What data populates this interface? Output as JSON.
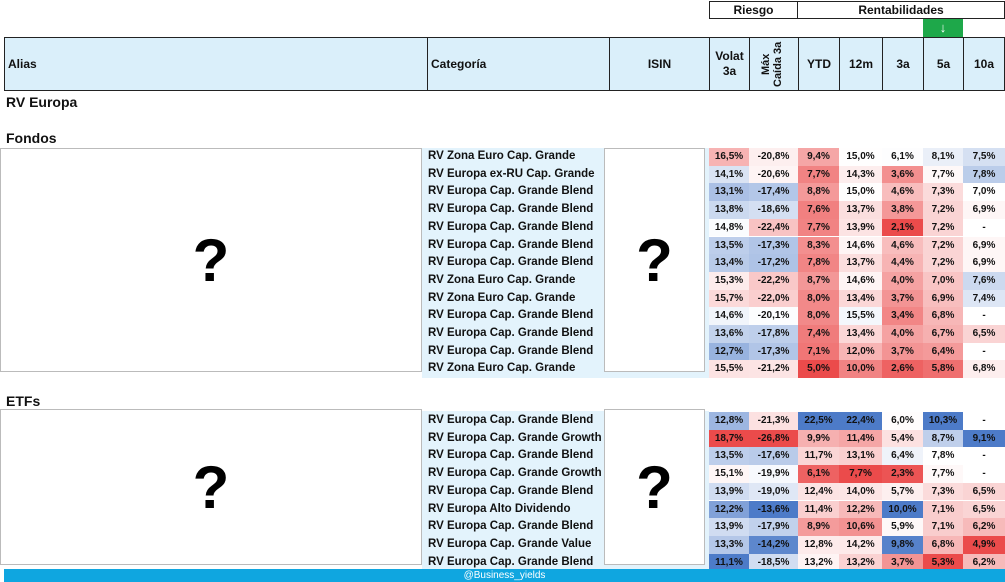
{
  "groups": {
    "risk": "Riesgo",
    "returns": "Rentabilidades"
  },
  "sort_arrow": "↓",
  "headers": {
    "alias": "Alias",
    "category": "Categoría",
    "isin": "ISIN",
    "vol": "Volat 3a",
    "maxdd": "Máx Caída 3a",
    "ytd": "YTD",
    "m12": "12m",
    "y3": "3a",
    "y5": "5a",
    "y10": "10a"
  },
  "sections": {
    "title": "RV Europa",
    "funds": "Fondos",
    "etfs": "ETFs"
  },
  "placeholders": {
    "alias": "?",
    "isin": "?"
  },
  "funds": [
    {
      "category": "RV Zona Euro Cap. Grande",
      "vol": "16,5%",
      "maxdd": "-20,8%",
      "ytd": "9,4%",
      "m12": "15,0%",
      "y3": "6,1%",
      "y5": "8,1%",
      "y10": "7,5%"
    },
    {
      "category": "RV Europa ex-RU Cap. Grande",
      "vol": "14,1%",
      "maxdd": "-20,6%",
      "ytd": "7,7%",
      "m12": "14,3%",
      "y3": "3,6%",
      "y5": "7,7%",
      "y10": "7,8%"
    },
    {
      "category": "RV Europa Cap. Grande Blend",
      "vol": "13,1%",
      "maxdd": "-17,4%",
      "ytd": "8,8%",
      "m12": "15,0%",
      "y3": "4,6%",
      "y5": "7,3%",
      "y10": "7,0%"
    },
    {
      "category": "RV Europa Cap. Grande Blend",
      "vol": "13,8%",
      "maxdd": "-18,6%",
      "ytd": "7,6%",
      "m12": "13,7%",
      "y3": "3,8%",
      "y5": "7,2%",
      "y10": "6,9%"
    },
    {
      "category": "RV Europa Cap. Grande Blend",
      "vol": "14,8%",
      "maxdd": "-22,4%",
      "ytd": "7,7%",
      "m12": "13,9%",
      "y3": "2,1%",
      "y5": "7,2%",
      "y10": "-"
    },
    {
      "category": "RV Europa Cap. Grande Blend",
      "vol": "13,5%",
      "maxdd": "-17,3%",
      "ytd": "8,3%",
      "m12": "14,6%",
      "y3": "4,6%",
      "y5": "7,2%",
      "y10": "6,9%"
    },
    {
      "category": "RV Europa Cap. Grande Blend",
      "vol": "13,4%",
      "maxdd": "-17,2%",
      "ytd": "7,8%",
      "m12": "13,7%",
      "y3": "4,4%",
      "y5": "7,2%",
      "y10": "6,9%"
    },
    {
      "category": "RV Zona Euro Cap. Grande",
      "vol": "15,3%",
      "maxdd": "-22,2%",
      "ytd": "8,7%",
      "m12": "14,6%",
      "y3": "4,0%",
      "y5": "7,0%",
      "y10": "7,6%"
    },
    {
      "category": "RV Zona Euro Cap. Grande",
      "vol": "15,7%",
      "maxdd": "-22,0%",
      "ytd": "8,0%",
      "m12": "13,4%",
      "y3": "3,7%",
      "y5": "6,9%",
      "y10": "7,4%"
    },
    {
      "category": "RV Europa Cap. Grande Blend",
      "vol": "14,6%",
      "maxdd": "-20,1%",
      "ytd": "8,0%",
      "m12": "15,5%",
      "y3": "3,4%",
      "y5": "6,8%",
      "y10": "-"
    },
    {
      "category": "RV Europa Cap. Grande Blend",
      "vol": "13,6%",
      "maxdd": "-17,8%",
      "ytd": "7,4%",
      "m12": "13,4%",
      "y3": "4,0%",
      "y5": "6,7%",
      "y10": "6,5%"
    },
    {
      "category": "RV Europa Cap. Grande Blend",
      "vol": "12,7%",
      "maxdd": "-17,3%",
      "ytd": "7,1%",
      "m12": "12,0%",
      "y3": "3,7%",
      "y5": "6,4%",
      "y10": "-"
    },
    {
      "category": "RV Zona Euro Cap. Grande",
      "vol": "15,5%",
      "maxdd": "-21,2%",
      "ytd": "5,0%",
      "m12": "10,0%",
      "y3": "2,6%",
      "y5": "5,8%",
      "y10": "6,8%"
    }
  ],
  "etfs": [
    {
      "category": "RV Europa Cap. Grande Blend",
      "vol": "12,8%",
      "maxdd": "-21,3%",
      "ytd": "22,5%",
      "m12": "22,4%",
      "y3": "6,0%",
      "y5": "10,3%",
      "y10": "-"
    },
    {
      "category": "RV Europa Cap. Grande Growth",
      "vol": "18,7%",
      "maxdd": "-26,8%",
      "ytd": "9,9%",
      "m12": "11,4%",
      "y3": "5,4%",
      "y5": "8,7%",
      "y10": "9,1%"
    },
    {
      "category": "RV Europa Cap. Grande Blend",
      "vol": "13,5%",
      "maxdd": "-17,6%",
      "ytd": "11,7%",
      "m12": "13,1%",
      "y3": "6,4%",
      "y5": "7,8%",
      "y10": "-"
    },
    {
      "category": "RV Europa Cap. Grande Growth",
      "vol": "15,1%",
      "maxdd": "-19,9%",
      "ytd": "6,1%",
      "m12": "7,7%",
      "y3": "2,3%",
      "y5": "7,7%",
      "y10": "-"
    },
    {
      "category": "RV Europa Cap. Grande Blend",
      "vol": "13,9%",
      "maxdd": "-19,0%",
      "ytd": "12,4%",
      "m12": "14,0%",
      "y3": "5,7%",
      "y5": "7,3%",
      "y10": "6,5%"
    },
    {
      "category": "RV Europa Alto Dividendo",
      "vol": "12,2%",
      "maxdd": "-13,6%",
      "ytd": "11,4%",
      "m12": "12,2%",
      "y3": "10,0%",
      "y5": "7,1%",
      "y10": "6,5%"
    },
    {
      "category": "RV Europa Cap. Grande Blend",
      "vol": "13,9%",
      "maxdd": "-17,9%",
      "ytd": "8,9%",
      "m12": "10,6%",
      "y3": "5,9%",
      "y5": "7,1%",
      "y10": "6,2%"
    },
    {
      "category": "RV Europa Cap. Grande Value",
      "vol": "13,3%",
      "maxdd": "-14,2%",
      "ytd": "12,8%",
      "m12": "14,2%",
      "y3": "9,8%",
      "y5": "6,8%",
      "y10": "4,9%"
    },
    {
      "category": "RV Europa Cap. Grande Blend",
      "vol": "11,1%",
      "maxdd": "-18,5%",
      "ytd": "13,2%",
      "m12": "13,2%",
      "y3": "3,7%",
      "y5": "5,3%",
      "y10": "6,2%"
    }
  ],
  "footer": "@Business_yields"
}
